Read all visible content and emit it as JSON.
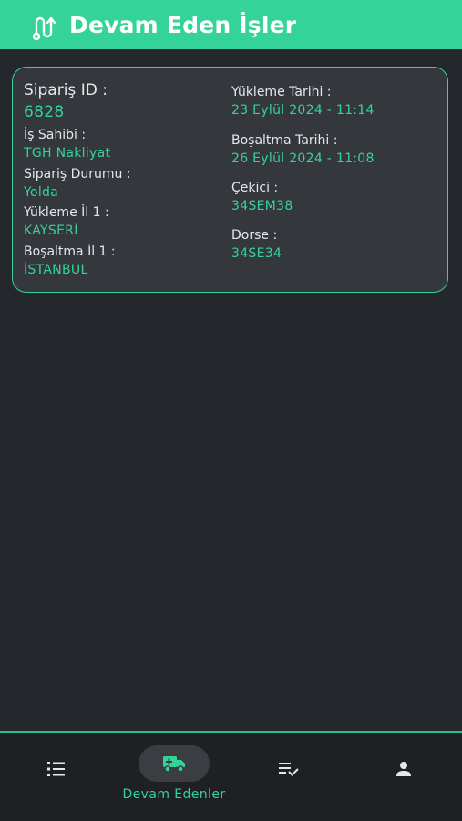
{
  "header": {
    "title": "Devam Eden İşler",
    "logo_icon": "route-icon"
  },
  "order": {
    "id_label": "Sipariş ID :",
    "id_value": "6828",
    "owner_label": "İş Sahibi :",
    "owner_value": "TGH Nakliyat",
    "status_label": "Sipariş Durumu :",
    "status_value": "Yolda",
    "load_city_label": "Yükleme İl 1 :",
    "load_city_value": "KAYSERİ",
    "unload_city_label": "Boşaltma İl 1 :",
    "unload_city_value": "İSTANBUL",
    "load_date_label": "Yükleme Tarihi :",
    "load_date_value": "23 Eylül 2024 - 11:14",
    "unload_date_label": "Boşaltma Tarihi :",
    "unload_date_value": "26 Eylül 2024 - 11:08",
    "tractor_label": "Çekici :",
    "tractor_value": "34SEM38",
    "trailer_label": "Dorse :",
    "trailer_value": "34SE34"
  },
  "bottom_nav": {
    "items": [
      {
        "icon": "list-icon",
        "label": ""
      },
      {
        "icon": "truck-icon",
        "label": "Devam Edenler",
        "active": true
      },
      {
        "icon": "checklist-icon",
        "label": ""
      },
      {
        "icon": "person-icon",
        "label": ""
      }
    ]
  },
  "colors": {
    "accent": "#34d399",
    "background": "#24272c",
    "card": "#34373b",
    "nav": "#1e2024"
  }
}
